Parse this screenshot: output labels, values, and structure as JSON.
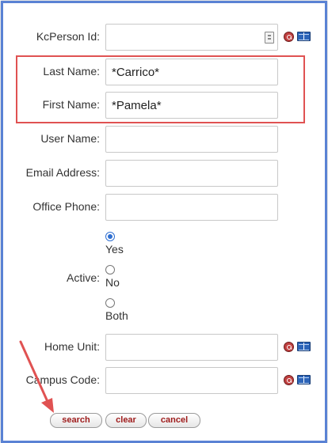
{
  "fields": [
    {
      "label": "KcPerson Id:",
      "value": "",
      "has_inner_icon": true,
      "has_lookup": true
    },
    {
      "label": "Last Name:",
      "value": "*Carrico*",
      "has_inner_icon": false,
      "has_lookup": false
    },
    {
      "label": "First Name:",
      "value": "*Pamela*",
      "has_inner_icon": false,
      "has_lookup": false
    },
    {
      "label": "User Name:",
      "value": "",
      "has_inner_icon": false,
      "has_lookup": false
    },
    {
      "label": "Email Address:",
      "value": "",
      "has_inner_icon": false,
      "has_lookup": false
    },
    {
      "label": "Office Phone:",
      "value": "",
      "has_inner_icon": false,
      "has_lookup": false
    }
  ],
  "active": {
    "label": "Active:",
    "options": [
      "Yes",
      "No",
      "Both"
    ],
    "selected": "Yes"
  },
  "lookup_fields": [
    {
      "label": "Home Unit:",
      "value": ""
    },
    {
      "label": "Campus Code:",
      "value": ""
    }
  ],
  "buttons": {
    "search": "search",
    "clear": "clear",
    "cancel": "cancel"
  },
  "icons": {
    "inner": "id-card-icon",
    "lookup": "magnifier-icon",
    "directory": "book-icon"
  },
  "colors": {
    "frame": "#5a82d4",
    "highlight": "#e05252",
    "arrow": "#e05252",
    "button_text": "#9e1b1b",
    "radio_selected": "#2f6fd1"
  }
}
